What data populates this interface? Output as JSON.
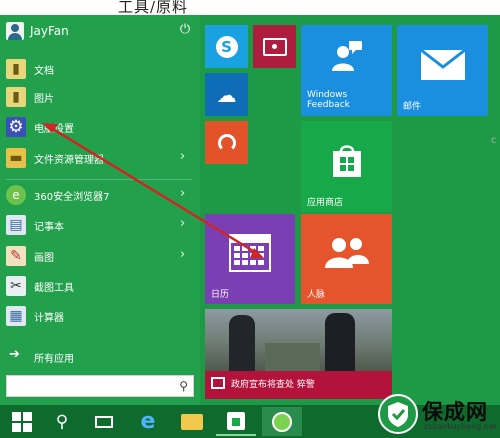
{
  "caption": "工具/原料",
  "user": {
    "name": "JayFan"
  },
  "left_items": [
    {
      "label": "文档",
      "icon": "folder-doc-icon",
      "has_submenu": false
    },
    {
      "label": "图片",
      "icon": "folder-pictures-icon",
      "has_submenu": false
    },
    {
      "label": "电脑设置",
      "icon": "gear-icon",
      "has_submenu": false
    },
    {
      "label": "文件资源管理器",
      "icon": "file-explorer-icon",
      "has_submenu": true
    },
    {
      "label": "360安全浏览器7",
      "icon": "browser-360-icon",
      "has_submenu": true
    },
    {
      "label": "记事本",
      "icon": "notepad-icon",
      "has_submenu": true
    },
    {
      "label": "画图",
      "icon": "paint-icon",
      "has_submenu": true
    },
    {
      "label": "截图工具",
      "icon": "snipping-tool-icon",
      "has_submenu": false
    },
    {
      "label": "计算器",
      "icon": "calculator-icon",
      "has_submenu": false
    }
  ],
  "all_apps": "所有应用",
  "tiles": {
    "feedback": "Windows Feedback",
    "mail": "邮件",
    "store": "应用商店",
    "calendar": "日历",
    "people": "人脉",
    "news_headline": "政府宣布将查处 猝警"
  },
  "colors": {
    "start_bg": "#1e9a46",
    "skype": "#1aa1e1",
    "video": "#ae1d3d",
    "onedrive": "#0f6cb6",
    "music": "#e4522a",
    "feedback": "#1a8fe0",
    "mail": "#1a8fe0",
    "store": "#17a84a",
    "calendar": "#7b3fb4",
    "people": "#e4552d",
    "news": "#b3123b",
    "annotation_arrow": "#d02525"
  },
  "watermark": {
    "title": "保成网",
    "url": "zsbaokucheng.net"
  },
  "edge_char": "c"
}
